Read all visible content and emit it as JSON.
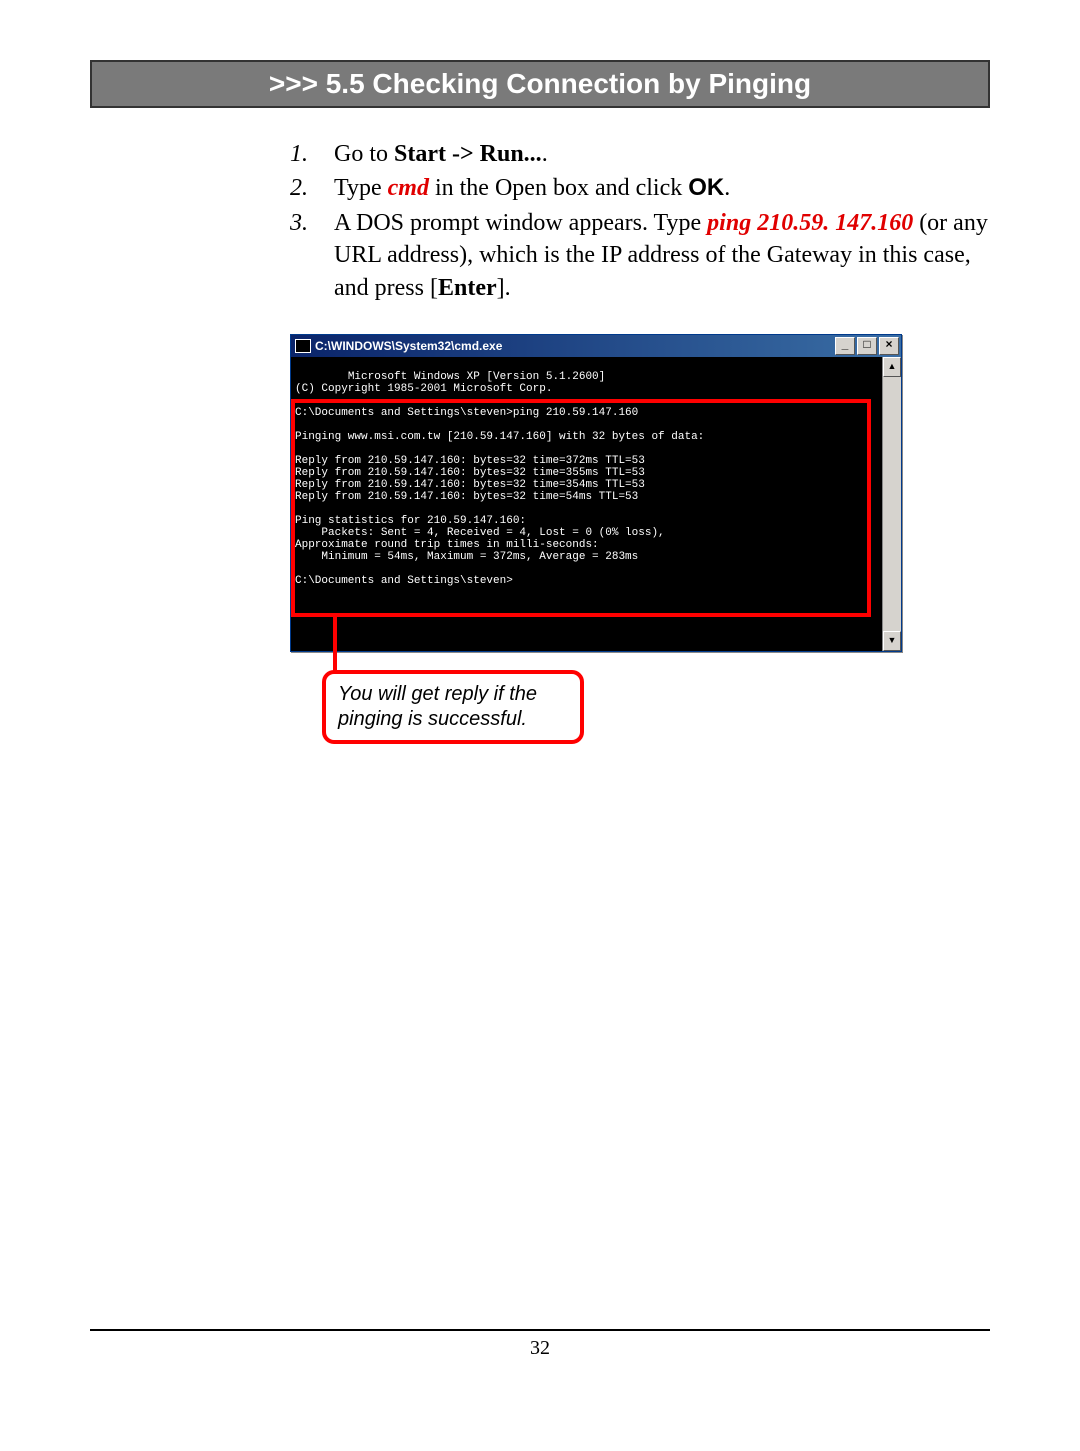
{
  "header": ">>> 5.5  Checking Connection by Pinging",
  "steps": {
    "s1": {
      "num": "1.",
      "a": "Go to ",
      "b": "Start -> Run...",
      "c": "."
    },
    "s2": {
      "num": "2.",
      "a": "Type ",
      "b": "cmd",
      "c": " in the Open box and click ",
      "d": "OK",
      "e": "."
    },
    "s3": {
      "num": "3.",
      "a": "A DOS prompt window appears.  Type ",
      "b": "ping 210.59. 147.160",
      "c": " (or any URL address), which is the IP address of the Gateway in this case, and press [",
      "d": "Enter",
      "e": "]."
    }
  },
  "cmd": {
    "title": "C:\\WINDOWS\\System32\\cmd.exe",
    "btn_min": "_",
    "btn_max": "□",
    "btn_close": "×",
    "scroll_up": "▲",
    "scroll_down": "▼",
    "lines": [
      "Microsoft Windows XP [Version 5.1.2600]",
      "(C) Copyright 1985-2001 Microsoft Corp.",
      "",
      "C:\\Documents and Settings\\steven>ping 210.59.147.160",
      "",
      "Pinging www.msi.com.tw [210.59.147.160] with 32 bytes of data:",
      "",
      "Reply from 210.59.147.160: bytes=32 time=372ms TTL=53",
      "Reply from 210.59.147.160: bytes=32 time=355ms TTL=53",
      "Reply from 210.59.147.160: bytes=32 time=354ms TTL=53",
      "Reply from 210.59.147.160: bytes=32 time=54ms TTL=53",
      "",
      "Ping statistics for 210.59.147.160:",
      "    Packets: Sent = 4, Received = 4, Lost = 0 (0% loss),",
      "Approximate round trip times in milli-seconds:",
      "    Minimum = 54ms, Maximum = 372ms, Average = 283ms",
      "",
      "C:\\Documents and Settings\\steven>"
    ]
  },
  "callout": "You will get reply if the pinging is successful.",
  "page_number": "32"
}
